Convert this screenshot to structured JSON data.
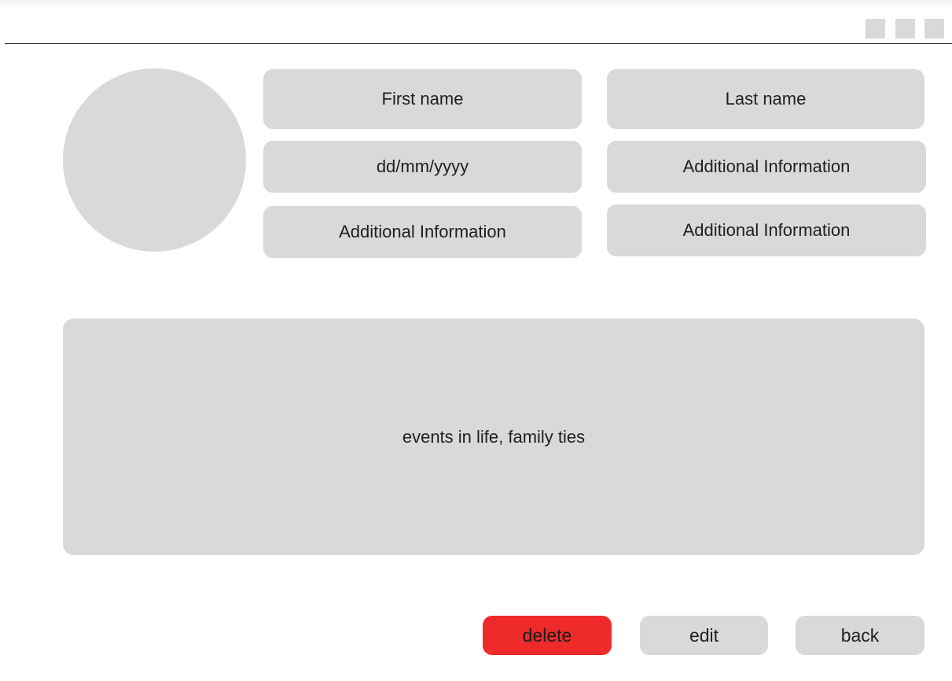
{
  "window": {
    "controls": [
      "window-button",
      "window-button",
      "window-button"
    ]
  },
  "profile": {
    "first_name": "First name",
    "last_name": "Last name",
    "birth_date": "dd/mm/yyyy",
    "info_1": "Additional Information",
    "info_2": "Additional Information",
    "info_3": "Additional Information",
    "bio": "events in life, family ties"
  },
  "actions": {
    "delete_label": "delete",
    "edit_label": "edit",
    "back_label": "back"
  },
  "colors": {
    "placeholder": "#d9d9d9",
    "danger": "#ee2a2a"
  }
}
